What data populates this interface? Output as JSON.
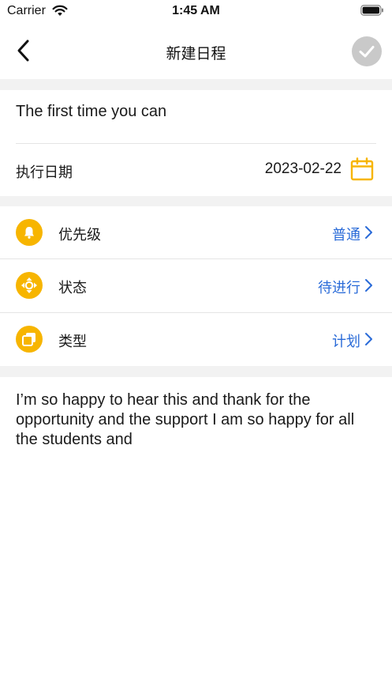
{
  "status_bar": {
    "carrier": "Carrier",
    "time": "1:45 AM"
  },
  "nav": {
    "title": "新建日程"
  },
  "form": {
    "title_text": "The first time you can",
    "date_label": "执行日期",
    "date_value": "2023-02-22"
  },
  "options": [
    {
      "label": "优先级",
      "value": "普通"
    },
    {
      "label": "状态",
      "value": "待进行"
    },
    {
      "label": "类型",
      "value": "计划"
    }
  ],
  "note": {
    "text": "I’m so happy to hear this and thank for the opportunity and the support I am so happy for all the students and"
  },
  "colors": {
    "accent": "#f7b500",
    "link": "#2a6bd8",
    "section_gap": "#f2f2f2",
    "confirm_disabled": "#c9c9c9"
  }
}
